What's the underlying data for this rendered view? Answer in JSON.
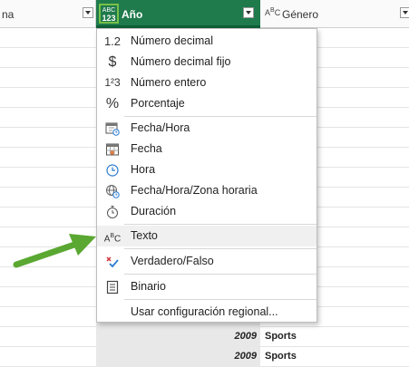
{
  "header": {
    "left_label": "na",
    "year_type": {
      "top": "ABC",
      "bottom": "123"
    },
    "year_label": "Año",
    "genre_type": "ABC",
    "genre_label": "Género"
  },
  "menu": {
    "items": [
      {
        "icon": "1.2",
        "label": "Número decimal"
      },
      {
        "icon": "$",
        "label": "Número decimal fijo"
      },
      {
        "icon": "1²3",
        "label": "Número entero"
      },
      {
        "icon": "%",
        "label": "Porcentaje"
      },
      {
        "icon": "calendar-clock-icon",
        "label": "Fecha/Hora"
      },
      {
        "icon": "calendar-icon",
        "label": "Fecha"
      },
      {
        "icon": "clock-icon",
        "label": "Hora"
      },
      {
        "icon": "globe-clock-icon",
        "label": "Fecha/Hora/Zona horaria"
      },
      {
        "icon": "stopwatch-icon",
        "label": "Duración"
      },
      {
        "icon": "ABC",
        "label": "Texto"
      },
      {
        "icon": "check-x-icon",
        "label": "Verdadero/Falso"
      },
      {
        "icon": "binary-icon",
        "label": "Binario"
      },
      {
        "icon": "",
        "label": "Usar configuración regional..."
      }
    ],
    "highlighted_index": 9
  },
  "rows": [
    {
      "year": "2009",
      "genre": "Sports"
    },
    {
      "year": "2009",
      "genre": "Sports"
    }
  ],
  "colors": {
    "header_selected": "#1f7a4c",
    "type_icon_border": "#77c048",
    "arrow": "#5aa832"
  }
}
